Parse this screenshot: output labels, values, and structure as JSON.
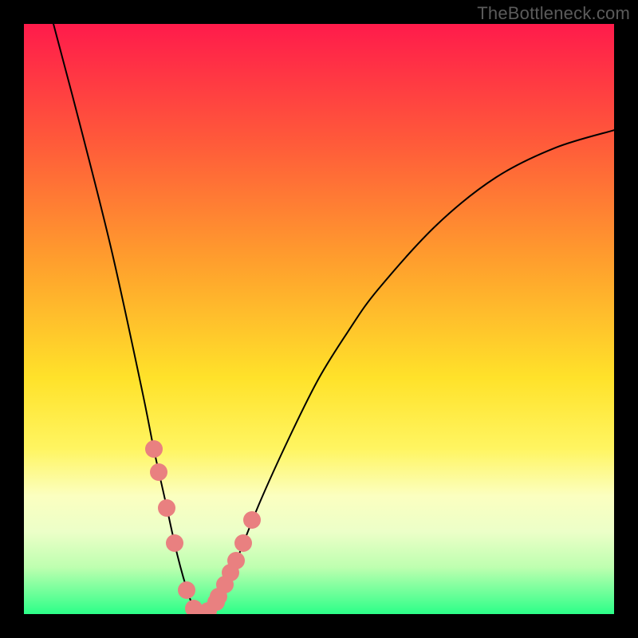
{
  "watermark": "TheBottleneck.com",
  "colors": {
    "bg": "#000000",
    "curve": "#000000",
    "marker": "#e98080",
    "watermark": "#5b5b5b",
    "gradient_stops": [
      {
        "offset": 0.0,
        "color": "#ff1b4b"
      },
      {
        "offset": 0.2,
        "color": "#ff5a3a"
      },
      {
        "offset": 0.4,
        "color": "#ff9e2d"
      },
      {
        "offset": 0.6,
        "color": "#ffe22a"
      },
      {
        "offset": 0.72,
        "color": "#fff561"
      },
      {
        "offset": 0.8,
        "color": "#fbffc0"
      },
      {
        "offset": 0.86,
        "color": "#ecffc8"
      },
      {
        "offset": 0.92,
        "color": "#bfffb0"
      },
      {
        "offset": 1.0,
        "color": "#2cff88"
      }
    ]
  },
  "chart_data": {
    "type": "line",
    "title": "",
    "xlabel": "",
    "ylabel": "",
    "xlim": [
      0,
      100
    ],
    "ylim": [
      0,
      100
    ],
    "grid": false,
    "series": [
      {
        "name": "bottleneck-curve",
        "x": [
          5,
          10,
          15,
          20,
          22,
          24,
          26,
          28,
          29,
          30,
          31,
          32,
          34,
          36,
          40,
          45,
          50,
          55,
          60,
          70,
          80,
          90,
          100
        ],
        "y": [
          100,
          81,
          61,
          38,
          28,
          19,
          10,
          3,
          1,
          0,
          0,
          1,
          4,
          9,
          19,
          30,
          40,
          48,
          55,
          66,
          74,
          79,
          82
        ]
      }
    ],
    "markers": {
      "name": "highlight-points",
      "x": [
        22.0,
        22.8,
        24.2,
        25.5,
        27.5,
        28.8,
        30.0,
        31.2,
        32.5,
        33.0,
        34.0,
        35.0,
        36.0,
        37.2,
        38.6
      ],
      "y": [
        28,
        24,
        18,
        12,
        4,
        1,
        0,
        0.5,
        2,
        3,
        5,
        7,
        9,
        12,
        16
      ]
    },
    "annotations": []
  }
}
